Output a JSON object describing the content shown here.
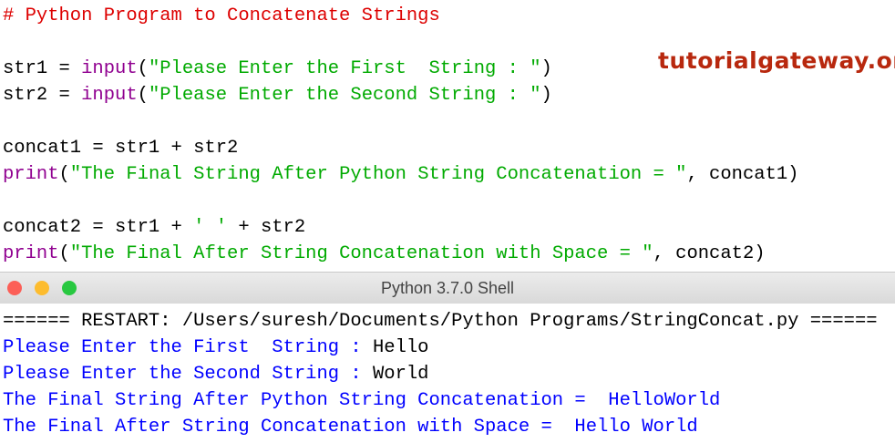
{
  "editor": {
    "lines": [
      [
        {
          "t": "# Python Program to Concatenate Strings",
          "c": "c"
        }
      ],
      [],
      [
        {
          "t": "str1 = ",
          "c": ""
        },
        {
          "t": "input",
          "c": "k"
        },
        {
          "t": "(",
          "c": ""
        },
        {
          "t": "\"Please Enter the First  String : \"",
          "c": "s"
        },
        {
          "t": ")",
          "c": ""
        }
      ],
      [
        {
          "t": "str2 = ",
          "c": ""
        },
        {
          "t": "input",
          "c": "k"
        },
        {
          "t": "(",
          "c": ""
        },
        {
          "t": "\"Please Enter the Second String : \"",
          "c": "s"
        },
        {
          "t": ")",
          "c": ""
        }
      ],
      [],
      [
        {
          "t": "concat1 = str1 + str2",
          "c": ""
        }
      ],
      [
        {
          "t": "print",
          "c": "k"
        },
        {
          "t": "(",
          "c": ""
        },
        {
          "t": "\"The Final String After Python String Concatenation = \"",
          "c": "s"
        },
        {
          "t": ", concat1)",
          "c": ""
        }
      ],
      [],
      [
        {
          "t": "concat2 = str1 + ",
          "c": ""
        },
        {
          "t": "' '",
          "c": "s"
        },
        {
          "t": " + str2",
          "c": ""
        }
      ],
      [
        {
          "t": "print",
          "c": "k"
        },
        {
          "t": "(",
          "c": ""
        },
        {
          "t": "\"The Final After String Concatenation with Space = \"",
          "c": "s"
        },
        {
          "t": ", concat2)",
          "c": ""
        }
      ]
    ]
  },
  "logo": "tutorialgateway.org",
  "shell": {
    "title": "Python 3.7.0 Shell",
    "lines": [
      [
        {
          "t": "====== RESTART: /Users/suresh/Documents/Python Programs/StringConcat.py ======",
          "c": ""
        }
      ],
      [
        {
          "t": "Please Enter the First  String : ",
          "c": "b"
        },
        {
          "t": "Hello",
          "c": ""
        }
      ],
      [
        {
          "t": "Please Enter the Second String : ",
          "c": "b"
        },
        {
          "t": "World",
          "c": ""
        }
      ],
      [
        {
          "t": "The Final String After Python String Concatenation =  HelloWorld",
          "c": "b"
        }
      ],
      [
        {
          "t": "The Final After String Concatenation with Space =  Hello World",
          "c": "b"
        }
      ]
    ]
  },
  "colors": {
    "close": "#fc5f57",
    "minimize": "#fdbc2e",
    "zoom": "#28c840"
  }
}
